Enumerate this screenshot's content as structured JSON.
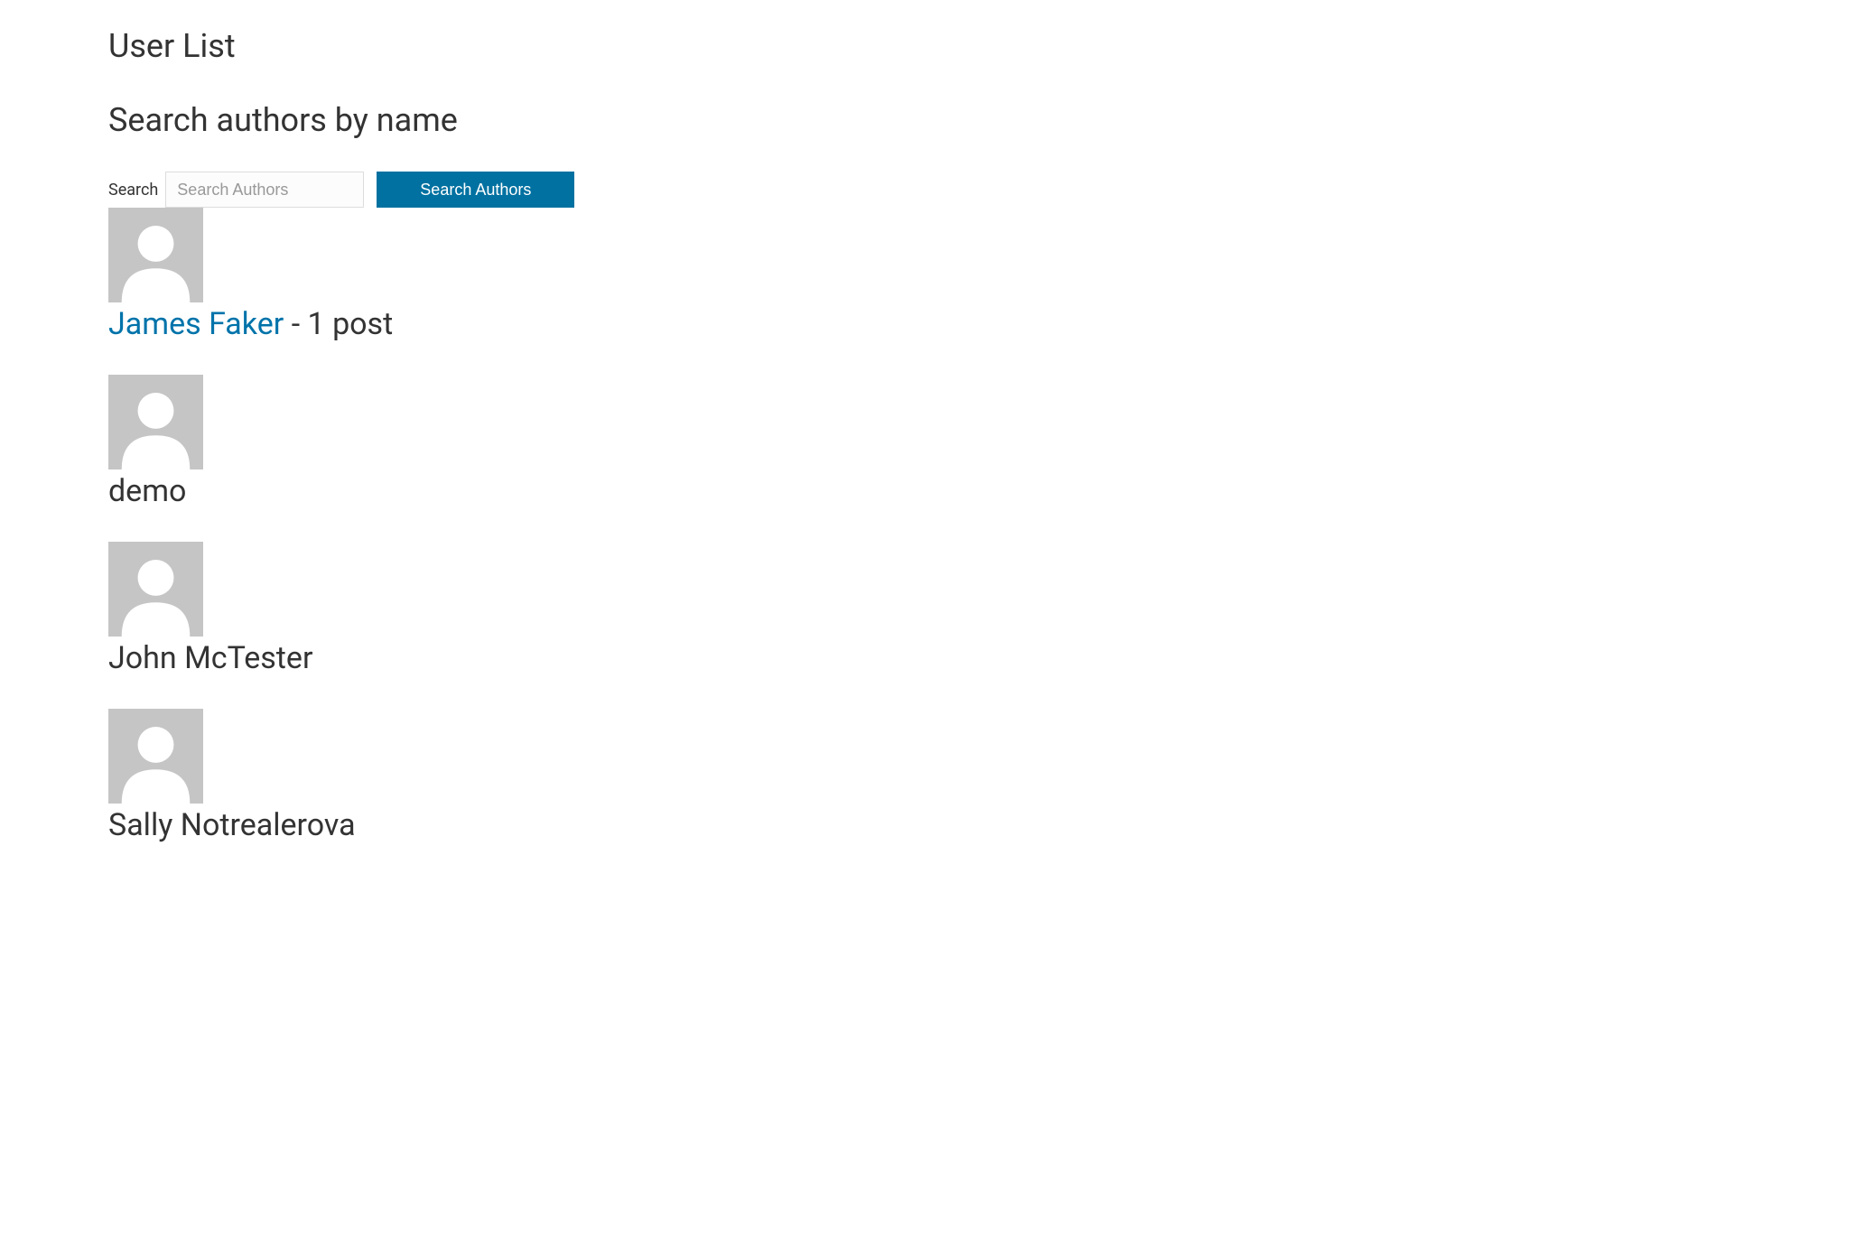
{
  "page": {
    "title": "User List",
    "section_heading": "Search authors by name"
  },
  "search": {
    "label": "Search",
    "placeholder": "Search Authors",
    "button_label": "Search Authors"
  },
  "users": [
    {
      "name": "James Faker",
      "is_link": true,
      "post_count_text": " - 1 post"
    },
    {
      "name": "demo",
      "is_link": false,
      "post_count_text": ""
    },
    {
      "name": "John McTester",
      "is_link": false,
      "post_count_text": ""
    },
    {
      "name": "Sally Notrealerova",
      "is_link": false,
      "post_count_text": ""
    }
  ]
}
